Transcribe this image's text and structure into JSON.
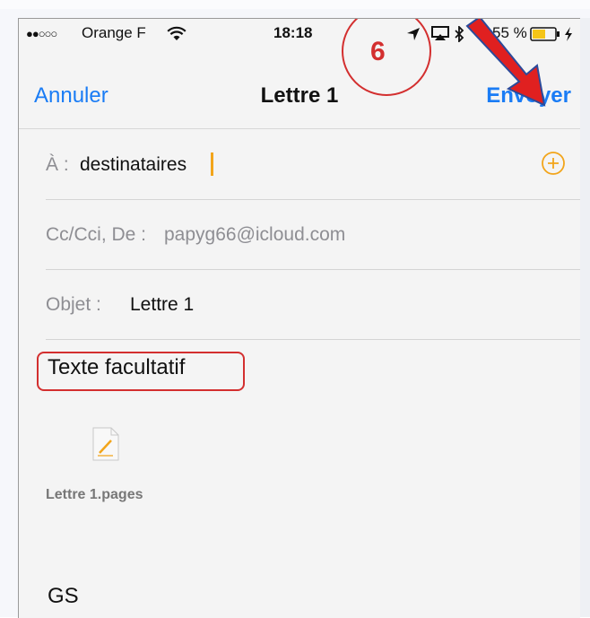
{
  "status_bar": {
    "signal_dots": "●●○○○",
    "carrier": "Orange F",
    "time": "18:18",
    "battery_percent": "55 %"
  },
  "nav": {
    "cancel_label": "Annuler",
    "title": "Lettre 1",
    "send_label": "Envoyer"
  },
  "compose": {
    "to_label": "À :",
    "to_value": "destinataires",
    "cc_label": "Cc/Cci, De :",
    "cc_value": "papyg66@icloud.com",
    "subject_label": "Objet :",
    "subject_value": "Lettre 1",
    "body_text": "Texte facultatif",
    "attachment_name": "Lettre 1.pages",
    "signature": "GS"
  },
  "annotation": {
    "step_number": "6"
  },
  "colors": {
    "accent": "#1a7cf5",
    "caret": "#f2a51b",
    "annotation_red": "#d32f2f"
  },
  "icons": [
    "wifi-icon",
    "location-arrow-icon",
    "airplay-icon",
    "bluetooth-icon",
    "battery-icon",
    "charging-icon",
    "add-contact-icon",
    "pages-document-icon",
    "red-arrow-icon"
  ]
}
